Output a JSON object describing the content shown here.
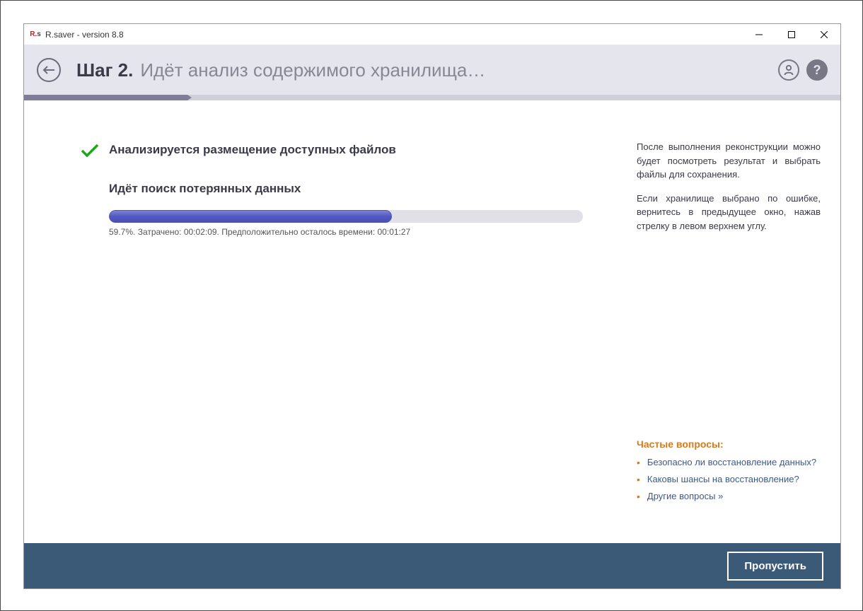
{
  "window": {
    "title": "R.saver - version 8.8"
  },
  "header": {
    "step_label": "Шаг 2.",
    "step_desc": "Идёт анализ содержимого хранилища…"
  },
  "steps": {
    "total": 5,
    "done": 1
  },
  "analysis": {
    "done_label": "Анализируется размещение доступных файлов",
    "search_label": "Идёт поиск потерянных данных",
    "progress_percent": 59.7,
    "progress_text": "59.7%. Затрачено: 00:02:09. Предположительно осталось времени: 00:01:27"
  },
  "sidebar": {
    "p1": "После выполнения реконструкции можно будет посмотреть результат и выбрать файлы для сохранения.",
    "p2": "Если хранилище выбрано по ошибке, вернитесь в предыдущее окно, нажав стрелку в левом верхнем углу.",
    "faq_title": "Частые вопросы:",
    "faq_items": [
      "Безопасно ли восстановление данных?",
      "Каковы шансы на восстановление?",
      "Другие вопросы »"
    ]
  },
  "footer": {
    "skip_label": "Пропустить"
  },
  "icons": {
    "back": "back-arrow-icon",
    "user": "user-icon",
    "help": "?"
  },
  "colors": {
    "header_bg": "#e5e5ed",
    "footer_bg": "#3b5a78",
    "accent_orange": "#d87a1a",
    "link": "#3b5a8c",
    "progress_fill": "#5358c1"
  }
}
